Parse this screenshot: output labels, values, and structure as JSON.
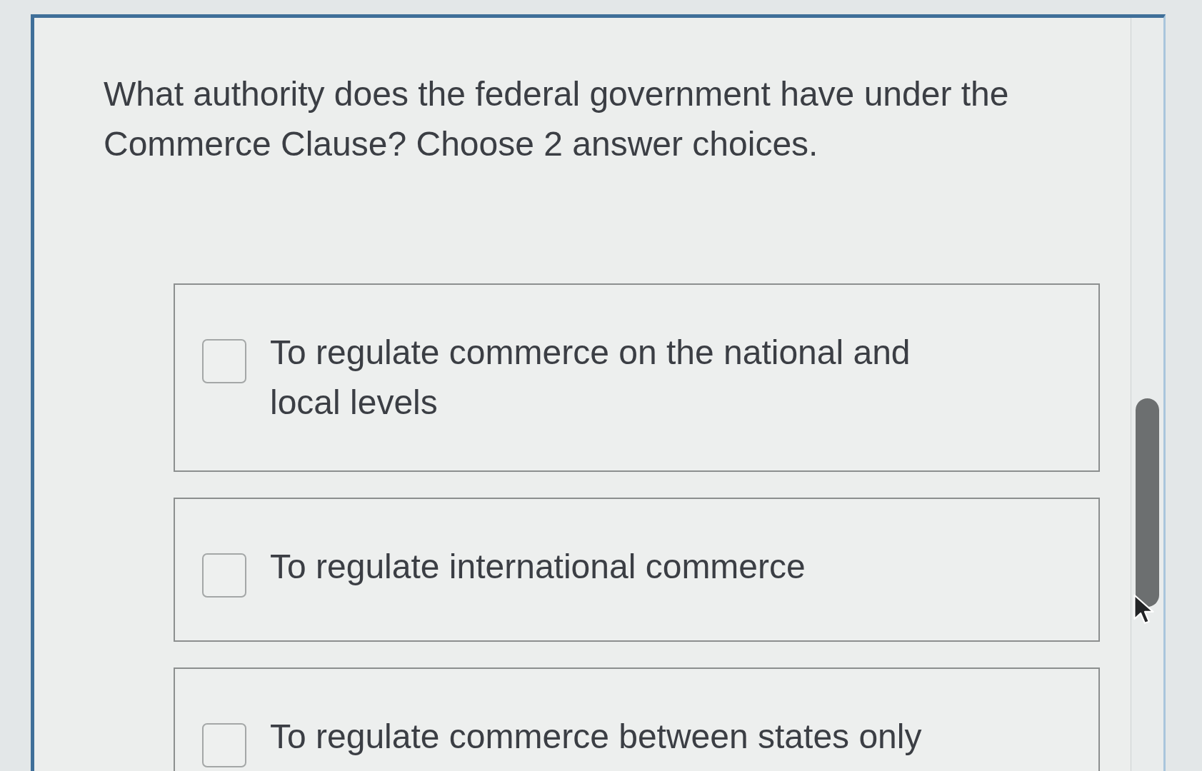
{
  "question": "What authority does the federal government have under the Commerce Clause? Choose 2 answer choices.",
  "options": [
    {
      "label": "To regulate commerce on the national and local levels",
      "checked": false
    },
    {
      "label": "To regulate international commerce",
      "checked": false
    },
    {
      "label": "To regulate commerce between states only",
      "checked": false
    }
  ]
}
